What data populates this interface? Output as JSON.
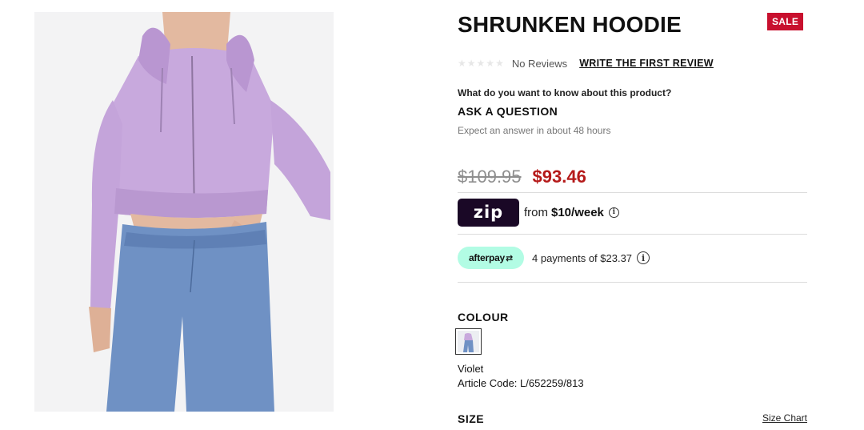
{
  "product": {
    "title": "SHRUNKEN HOODIE",
    "sale_badge": "SALE",
    "image_alt": "Model wearing lilac cropped zip hoodie with blue jeans"
  },
  "reviews": {
    "star_icon": "star-icon",
    "stars": 5,
    "no_reviews_text": "No Reviews",
    "write_review_label": "WRITE THE FIRST REVIEW"
  },
  "questions": {
    "prompt": "What do you want to know about this product?",
    "ask_label": "ASK A QUESTION",
    "answer_time": "Expect an answer in about 48 hours"
  },
  "pricing": {
    "original_price": "$109.95",
    "sale_price": "$93.46",
    "sale_color": "#b51a1a"
  },
  "zip": {
    "logo_text": "zip",
    "from_text": "from",
    "amount_text": "$10/week",
    "info_icon": "info-icon"
  },
  "afterpay": {
    "badge_text": "afterpay",
    "payments_text": "4 payments of $23.37",
    "info_icon": "info-icon",
    "badge_color": "#b2fce4"
  },
  "colour": {
    "label": "COLOUR",
    "selected_name": "Violet",
    "article_code": "Article Code: L/652259/813"
  },
  "size": {
    "label": "SIZE",
    "size_chart_label": "Size Chart"
  }
}
